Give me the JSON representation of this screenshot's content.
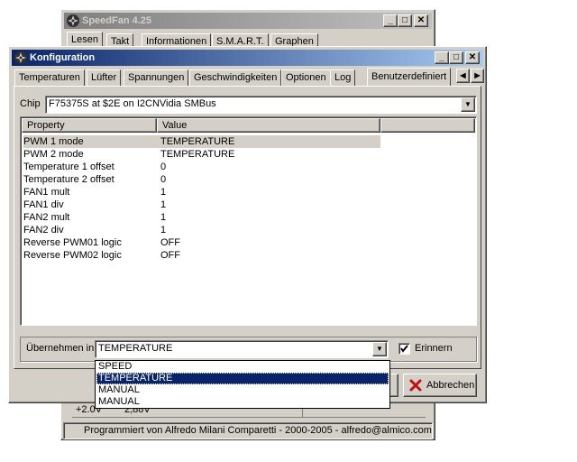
{
  "back_window": {
    "title": "SpeedFan 4.25",
    "tabs": [
      "Lesen",
      "Takt",
      "Informationen",
      "S.M.A.R.T.",
      "Graphen"
    ],
    "bottom_values": [
      "+2.0V",
      "2,88V"
    ],
    "status": "Programmiert von Alfredo Milani Comparetti - 2000-2005 - alfredo@almico.com"
  },
  "dialog": {
    "title": "Konfiguration",
    "tabs": [
      "Temperaturen",
      "Lüfter",
      "Spannungen",
      "Geschwindigkeiten",
      "Optionen",
      "Log",
      "Benutzerdefiniert"
    ],
    "chip_label": "Chip",
    "chip_value": "F75375S at $2E on I2CNVidia SMBus",
    "columns": [
      "Property",
      "Value"
    ],
    "rows": [
      {
        "property": "PWM 1 mode",
        "value": "TEMPERATURE"
      },
      {
        "property": "PWM 2 mode",
        "value": "TEMPERATURE"
      },
      {
        "property": "Temperature 1 offset",
        "value": "0"
      },
      {
        "property": "Temperature 2 offset",
        "value": "0"
      },
      {
        "property": "FAN1 mult",
        "value": "1"
      },
      {
        "property": "FAN1 div",
        "value": "1"
      },
      {
        "property": "FAN2 mult",
        "value": "1"
      },
      {
        "property": "FAN2 div",
        "value": "1"
      },
      {
        "property": "Reverse PWM01 logic",
        "value": "OFF"
      },
      {
        "property": "Reverse PWM02 logic",
        "value": "OFF"
      }
    ],
    "apply_label": "Übernehmen in",
    "apply_value": "TEMPERATURE",
    "remember_label": "Erinnern",
    "remember_checked": true,
    "dropdown_options": [
      "SPEED",
      "TEMPERATURE",
      "MANUAL",
      "MANUAL"
    ],
    "dropdown_selected": "TEMPERATURE",
    "cancel_label": "Abbrechen"
  },
  "colors": {
    "title_active": "#0a246a",
    "title_inactive": "#808080",
    "selection": "#0a246a",
    "row_highlight": "#d4d0c8"
  }
}
